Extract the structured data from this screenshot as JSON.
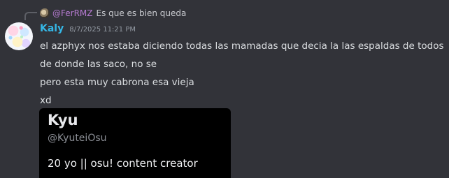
{
  "reply": {
    "username": "@FerRMZ",
    "text": "Es que es bien queda"
  },
  "message": {
    "author": "Kaly",
    "timestamp": "8/7/2025 11:21 PM",
    "lines": [
      "el azphyx nos estaba diciendo todas las mamadas que decia la las espaldas de todos",
      "de donde las saco, no se",
      "pero esta muy cabrona esa vieja",
      "xd"
    ]
  },
  "embed": {
    "name": "Kyu",
    "handle": "@KyuteiOsu",
    "bio": "20 yo || osu! content creator"
  },
  "colors": {
    "background": "#323339",
    "author": "#35b7e6",
    "reply_user": "#b57ad0",
    "embed_bg": "#000000"
  }
}
